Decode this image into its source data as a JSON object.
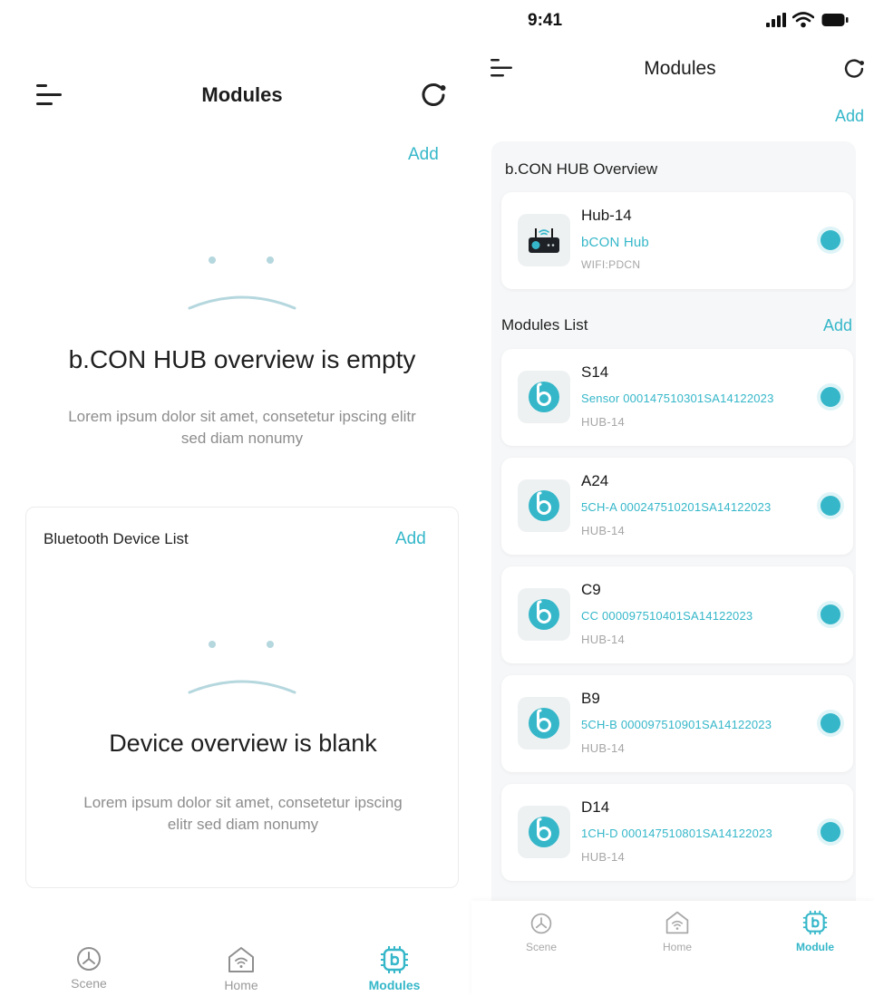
{
  "left": {
    "header": {
      "title": "Modules",
      "add_label": "Add",
      "menu_icon": "menu-icon",
      "refresh_icon": "refresh-icon"
    },
    "hub_empty": {
      "title": "b.CON HUB overview is empty",
      "description_line1": "Lorem ipsum dolor sit amet, consetetur ipscing elitr",
      "description_line2": "sed diam nonumy"
    },
    "bluetooth": {
      "label": "Bluetooth Device List",
      "add_label": "Add",
      "empty_title": "Device overview is blank",
      "description_line1": "Lorem ipsum dolor sit amet, consetetur ipscing",
      "description_line2": "elitr sed diam nonumy"
    },
    "tabs": [
      {
        "label": "Scene",
        "icon": "scene-icon",
        "active": false
      },
      {
        "label": "Home",
        "icon": "home-icon",
        "active": false
      },
      {
        "label": "Modules",
        "icon": "module-icon",
        "active": true
      }
    ]
  },
  "right": {
    "status": {
      "time": "9:41"
    },
    "header": {
      "title": "Modules",
      "add_label": "Add"
    },
    "hub_section": {
      "label": "b.CON HUB Overview",
      "hub": {
        "name": "Hub-14",
        "type": "bCON Hub",
        "network": "WIFI:PDCN"
      }
    },
    "modules_section": {
      "label": "Modules List",
      "add_label": "Add",
      "modules": [
        {
          "name": "S14",
          "detail": "Sensor 000147510301SA14122023",
          "hub": "HUB-14"
        },
        {
          "name": "A24",
          "detail": "5CH-A 000247510201SA14122023",
          "hub": "HUB-14"
        },
        {
          "name": "C9",
          "detail": "CC 000097510401SA14122023",
          "hub": "HUB-14"
        },
        {
          "name": "B9",
          "detail": "5CH-B 000097510901SA14122023",
          "hub": "HUB-14"
        },
        {
          "name": "D14",
          "detail": "1CH-D 000147510801SA14122023",
          "hub": "HUB-14"
        }
      ]
    },
    "tabs": [
      {
        "label": "Scene",
        "icon": "scene-icon",
        "active": false
      },
      {
        "label": "Home",
        "icon": "home-icon",
        "active": false
      },
      {
        "label": "Module",
        "icon": "module-icon",
        "active": true
      }
    ]
  },
  "colors": {
    "accent": "#35b7c9",
    "muted": "#8d8d8d",
    "panel": "#f6f7f8"
  }
}
